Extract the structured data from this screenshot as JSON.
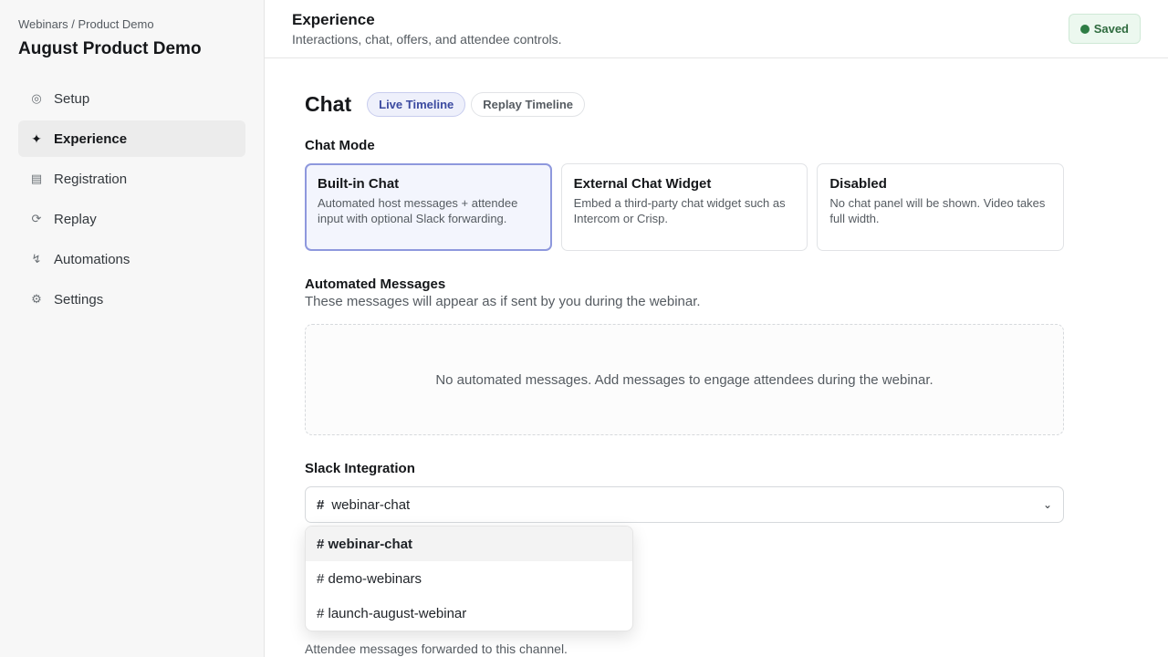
{
  "sidebar": {
    "breadcrumb": "Webinars / Product Demo",
    "title": "August Product Demo",
    "items": [
      {
        "label": "Setup",
        "icon": "circle-icon",
        "glyph": "◎"
      },
      {
        "label": "Experience",
        "icon": "sparkle-icon",
        "glyph": "✦"
      },
      {
        "label": "Registration",
        "icon": "form-icon",
        "glyph": "▤"
      },
      {
        "label": "Replay",
        "icon": "replay-icon",
        "glyph": "⟳"
      },
      {
        "label": "Automations",
        "icon": "bolt-icon",
        "glyph": "↯"
      },
      {
        "label": "Settings",
        "icon": "gear-icon",
        "glyph": "⚙"
      }
    ],
    "active_item": "Experience"
  },
  "header": {
    "title": "Experience",
    "subtitle": "Interactions, chat, offers, and attendee controls.",
    "status": "Saved",
    "status_color": "#2e7d45"
  },
  "main": {
    "heading": "Chat",
    "tabs": [
      {
        "label": "Live Timeline",
        "active": true
      },
      {
        "label": "Replay Timeline",
        "active": false
      }
    ],
    "chat_mode": {
      "label": "Chat Mode",
      "options": [
        {
          "title": "Built-in Chat",
          "description": "Automated host messages + attendee input with optional Slack forwarding.",
          "selected": true
        },
        {
          "title": "External Chat Widget",
          "description": "Embed a third-party chat widget such as Intercom or Crisp.",
          "selected": false
        },
        {
          "title": "Disabled",
          "description": "No chat panel will be shown. Video takes full width.",
          "selected": false
        }
      ]
    },
    "automated_messages": {
      "title": "Automated Messages",
      "subtitle": "These messages will appear as if sent by you during the webinar.",
      "empty_text": "No automated messages. Add messages to engage attendees during the webinar."
    },
    "slack": {
      "label": "Slack Integration",
      "selected_channel": "webinar-chat",
      "hash": "#",
      "options": [
        "# webinar-chat",
        "# demo-webinars",
        "# launch-august-webinar"
      ],
      "helper": "Attendee messages forwarded to this channel."
    }
  },
  "colors": {
    "accent": "#3b4aa0",
    "selected_border": "#8e98dd",
    "saved_badge_bg": "#ecf8ef"
  }
}
